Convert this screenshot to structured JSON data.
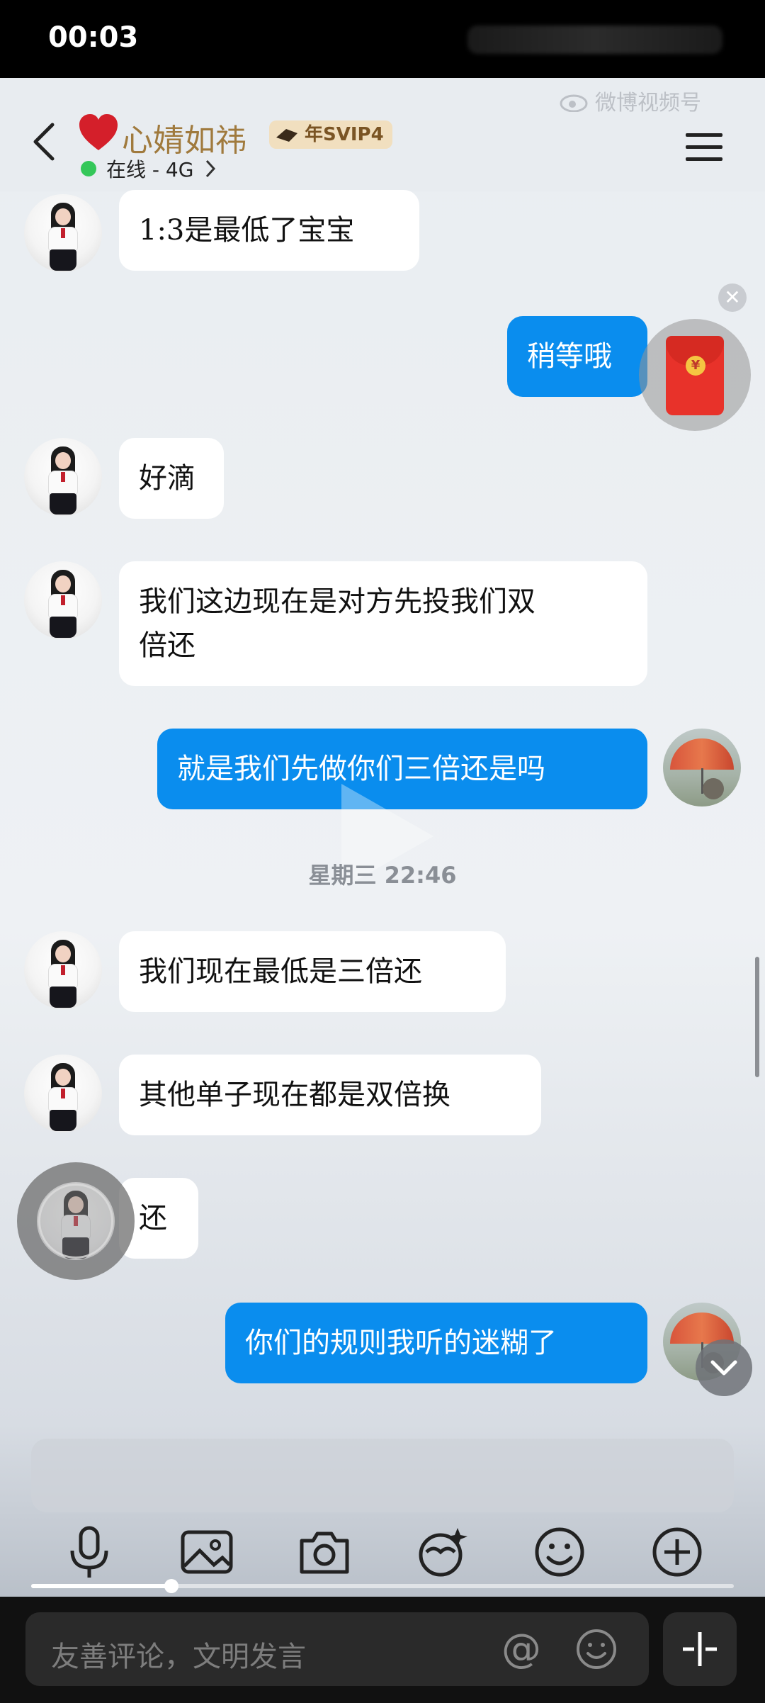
{
  "status_bar": {
    "time": "00:03"
  },
  "header": {
    "title": "心婧如祎",
    "vip_badge": "年SVIP4",
    "status": "在线 - 4G",
    "watermark": "微博视频号"
  },
  "messages": [
    {
      "side": "in",
      "text": "1:3是最低了宝宝"
    },
    {
      "side": "out",
      "text": "稍等哦"
    },
    {
      "side": "in",
      "text": "好滴"
    },
    {
      "side": "in",
      "text": "我们这边现在是对方先投我们双\n倍还"
    },
    {
      "side": "out",
      "text": "就是我们先做你们三倍还是吗"
    },
    {
      "side": "in",
      "text": "我们现在最低是三倍还"
    },
    {
      "side": "in",
      "text": "其他单子现在都是双倍换"
    },
    {
      "side": "in",
      "text": "还"
    },
    {
      "side": "out",
      "text": "你们的规则我听的迷糊了"
    }
  ],
  "timestamp": "星期三 22:46",
  "redpacket_symbol": "¥",
  "toolbar_icons": [
    "microphone-icon",
    "image-icon",
    "camera-icon",
    "sticker-icon",
    "emoji-icon",
    "plus-icon"
  ],
  "video_progress": 0.2,
  "comment_bar": {
    "placeholder": "友善评论，文明发言",
    "at_symbol": "@"
  }
}
